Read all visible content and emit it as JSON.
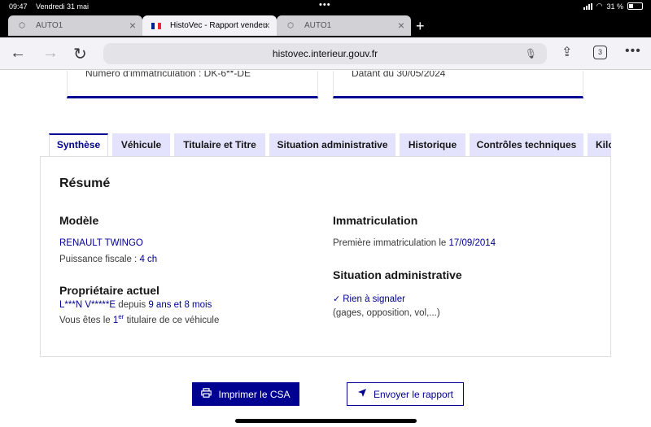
{
  "status_bar": {
    "time": "09:47",
    "date": "Vendredi 31 mai",
    "battery": "31 %"
  },
  "browser": {
    "tabs": [
      {
        "label": "AUTO1",
        "active": false
      },
      {
        "label": "HistoVec - Rapport vendeur",
        "active": true
      },
      {
        "label": "AUTO1",
        "active": false
      }
    ],
    "url": "histovec.interieur.gouv.fr",
    "tab_count": "3"
  },
  "top_cards": {
    "plate": "Numéro d'immatriculation : DK-6**-DE",
    "dated": "Datant du 30/05/2024"
  },
  "page_tabs": [
    "Synthèse",
    "Véhicule",
    "Titulaire et Titre",
    "Situation administrative",
    "Historique",
    "Contrôles techniques",
    "Kilo"
  ],
  "summary": {
    "title": "Résumé",
    "model_heading": "Modèle",
    "model_name": "RENAULT TWINGO",
    "fiscal_label": "Puissance fiscale : ",
    "fiscal_value": "4 ch",
    "owner_heading": "Propriétaire actuel",
    "owner_name": "L***N V*****E",
    "owner_since_label": " depuis ",
    "owner_since_value": "9 ans et 8 mois",
    "owner_rank_prefix": "Vous êtes le ",
    "owner_rank_value": "1",
    "owner_rank_sup": "er",
    "owner_rank_suffix": " titulaire de ce véhicule",
    "registration_heading": "Immatriculation",
    "first_reg_label": "Première immatriculation le ",
    "first_reg_value": "17/09/2014",
    "admin_heading": "Situation administrative",
    "admin_status": "Rien à signaler",
    "admin_note": "(gages, opposition, vol,...)"
  },
  "actions": {
    "print_label": "Imprimer le CSA",
    "send_label": "Envoyer le rapport"
  }
}
